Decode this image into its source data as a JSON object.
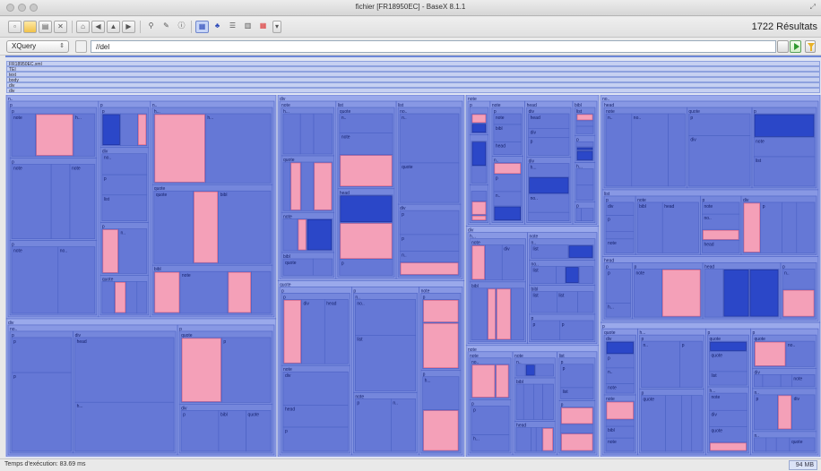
{
  "window": {
    "title": "fichier [FR18950EC] - BaseX 8.1.1"
  },
  "toolbar": {
    "results": "1722 Résultats",
    "buttons": [
      {
        "icon": "new-file-icon"
      },
      {
        "icon": "open-folder-icon"
      },
      {
        "icon": "database-icon"
      },
      {
        "icon": "close-database-icon"
      },
      {
        "icon": "home-icon"
      },
      {
        "icon": "back-icon"
      },
      {
        "icon": "up-icon"
      },
      {
        "icon": "forward-icon"
      },
      {
        "icon": "find-icon"
      },
      {
        "icon": "tools-icon"
      },
      {
        "icon": "info-icon"
      },
      {
        "icon": "map-view-icon"
      },
      {
        "icon": "tree-view-icon"
      },
      {
        "icon": "folder-view-icon"
      },
      {
        "icon": "table-view-icon"
      },
      {
        "icon": "plot-view-icon"
      },
      {
        "icon": "more-icon"
      }
    ]
  },
  "query": {
    "mode": "XQuery",
    "value": "//del"
  },
  "map": {
    "root_label": "FR18950EC.xml",
    "path_labels": [
      "TEI",
      "text",
      "body",
      "div",
      "div"
    ],
    "colors": {
      "accent": "#6b86d8",
      "cell": "#8fa0e6",
      "deep": "#2b47c8",
      "highlight": "#f4a0b8"
    },
    "cell_labels": [
      "div",
      "p",
      "note",
      "n..",
      "no..",
      "div",
      "p",
      "note",
      "p",
      "bibl",
      "head",
      "list",
      "quote",
      "h..."
    ]
  },
  "status": {
    "text": "Temps d'exécution: 83.69 ms",
    "memory": "94 MB"
  }
}
